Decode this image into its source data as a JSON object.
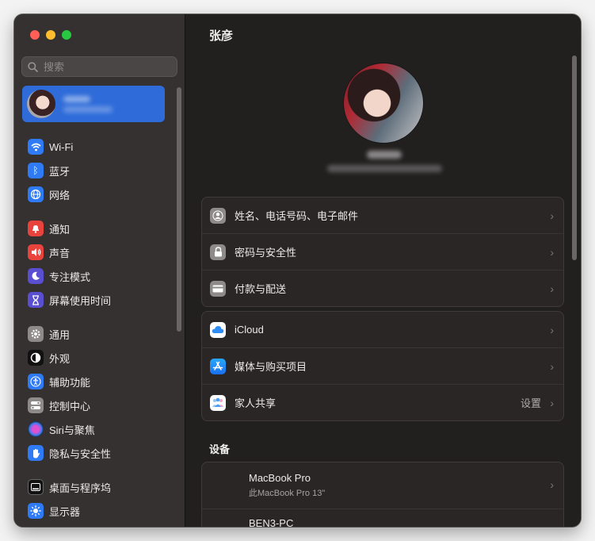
{
  "sidebar": {
    "search_placeholder": "搜索",
    "items": [
      {
        "label": "Wi-Fi",
        "icon": "wifi-icon",
        "color": "#2f7bf5"
      },
      {
        "label": "蓝牙",
        "icon": "bluetooth-icon",
        "color": "#2f7bf5"
      },
      {
        "label": "网络",
        "icon": "globe-icon",
        "color": "#2f7bf5"
      },
      {
        "label": "通知",
        "icon": "bell-icon",
        "color": "#e8433c"
      },
      {
        "label": "声音",
        "icon": "speaker-icon",
        "color": "#e8433c"
      },
      {
        "label": "专注模式",
        "icon": "moon-icon",
        "color": "#5a4fd1"
      },
      {
        "label": "屏幕使用时间",
        "icon": "hourglass-icon",
        "color": "#5a4fd1"
      },
      {
        "label": "通用",
        "icon": "gear-icon",
        "color": "#8e8a8a"
      },
      {
        "label": "外观",
        "icon": "appearance-icon",
        "color": "#111111"
      },
      {
        "label": "辅助功能",
        "icon": "accessibility-icon",
        "color": "#2f7bf5"
      },
      {
        "label": "控制中心",
        "icon": "control-center-icon",
        "color": "#8e8a8a"
      },
      {
        "label": "Siri与聚焦",
        "icon": "siri-icon",
        "color": "#9b3dd6"
      },
      {
        "label": "隐私与安全性",
        "icon": "hand-icon",
        "color": "#2f7bf5"
      },
      {
        "label": "桌面与程序坞",
        "icon": "dock-icon",
        "color": "#111111"
      },
      {
        "label": "显示器",
        "icon": "sun-icon",
        "color": "#2f7bf5"
      }
    ]
  },
  "main": {
    "title": "张彦",
    "group1": [
      {
        "label": "姓名、电话号码、电子邮件",
        "icon": "person-icon",
        "color": "#8e8a8a"
      },
      {
        "label": "密码与安全性",
        "icon": "lock-icon",
        "color": "#8e8a8a"
      },
      {
        "label": "付款与配送",
        "icon": "card-icon",
        "color": "#8e8a8a"
      }
    ],
    "group2": [
      {
        "label": "iCloud",
        "icon": "cloud-icon",
        "color": "#ffffff",
        "trailing": ""
      },
      {
        "label": "媒体与购买项目",
        "icon": "app-store-icon",
        "color": "#1b8bf5",
        "trailing": ""
      },
      {
        "label": "家人共享",
        "icon": "family-icon",
        "color": "#ffffff",
        "trailing": "设置"
      }
    ],
    "devices_heading": "设备",
    "devices": [
      {
        "name": "MacBook Pro",
        "sub": "此MacBook Pro 13\""
      },
      {
        "name": "BEN3-PC",
        "sub": ""
      }
    ]
  }
}
